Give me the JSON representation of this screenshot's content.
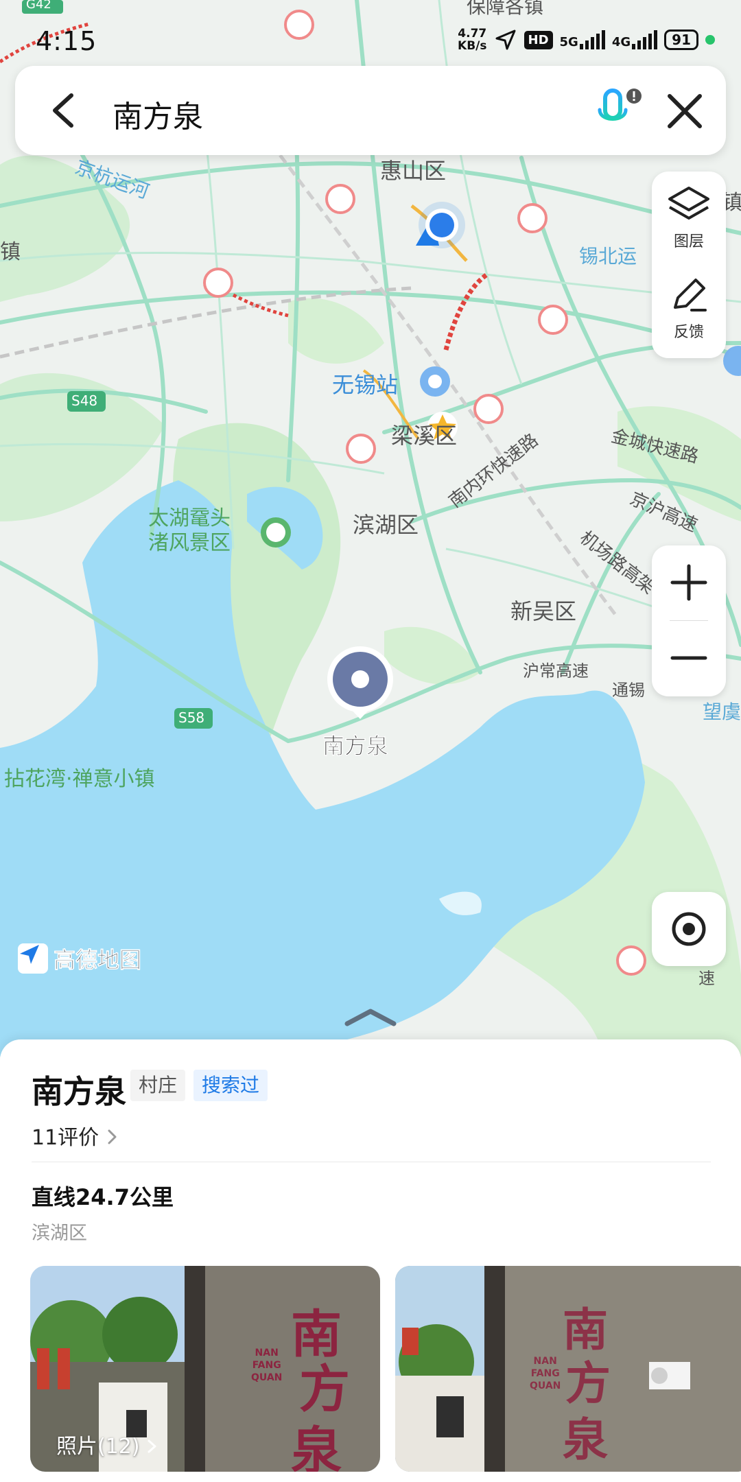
{
  "status_bar": {
    "time": "4:15",
    "speed_value": "4.77",
    "speed_unit": "KB/s",
    "hd_badge": "HD",
    "net1": "5G",
    "net2": "4G",
    "battery": "91"
  },
  "search": {
    "query": "南方泉"
  },
  "map_controls": {
    "layers_label": "图层",
    "feedback_label": "反馈"
  },
  "map_labels": {
    "top_partial": "保障各镇",
    "g42": "G42",
    "huishan": "惠山区",
    "canal": "京杭运河",
    "xibei_canal": "锡北运",
    "zhen": "镇",
    "zhen_left": "镇",
    "wuxi_station": "无锡站",
    "liangxi": "梁溪区",
    "s48": "S48",
    "nannei_expressway": "南内环快速路",
    "jincheng_expressway": "金城快速路",
    "jinghu_expressway": "京沪高速",
    "taihu_scenic": "太湖鼋头\n渚风景区",
    "binhu": "滨湖区",
    "airport_road": "机场路高架",
    "xinwu": "新吴区",
    "huchang_expressway": "沪常高速",
    "tongxi": "通锡",
    "wangyu": "望虞",
    "s58": "S58",
    "poi_label": "南方泉",
    "nianhua_bay": "拈花湾·禅意小镇",
    "speed_partial": "速",
    "logo_text": "高德地图"
  },
  "poi": {
    "name": "南方泉",
    "tag_type": "村庄",
    "tag_history": "搜索过",
    "reviews": "11评价",
    "distance": "直线24.7公里",
    "district": "滨湖区",
    "photos_label": "照片(12)",
    "sign_char1": "南",
    "sign_char2": "方",
    "sign_char3": "泉",
    "sign_pinyin": "NAN\nFANG\nQUAN"
  },
  "colors": {
    "water": "#9fdcf6",
    "green": "#cfeccf",
    "road": "#9edfc5",
    "accent_blue": "#1e7ae6",
    "poi_marker": "#6a7aa6"
  }
}
